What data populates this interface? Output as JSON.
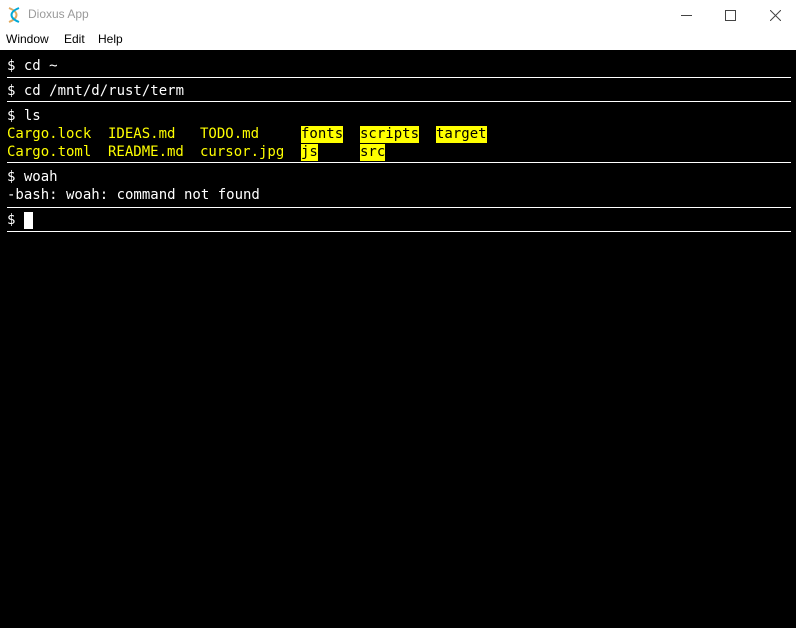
{
  "window": {
    "title": "Dioxus App",
    "minimize_glyph": "—",
    "maximize_glyph": "☐",
    "close_glyph": "✕"
  },
  "menu": {
    "items": [
      "Window",
      "Edit",
      "Help"
    ]
  },
  "terminal": {
    "background": "#000000",
    "foreground": "#ffffff",
    "file_color": "#ffff00",
    "entries": [
      {
        "command": "$ cd ~"
      },
      {
        "command": "$ cd /mnt/d/rust/term"
      },
      {
        "command": "$ ls",
        "files": [
          {
            "name": "Cargo.lock",
            "kind": "file"
          },
          {
            "name": "IDEAS.md",
            "kind": "file"
          },
          {
            "name": "TODO.md",
            "kind": "file"
          },
          {
            "name": "fonts",
            "kind": "directory"
          },
          {
            "name": "scripts",
            "kind": "directory"
          },
          {
            "name": "target",
            "kind": "directory"
          },
          {
            "name": "Cargo.toml",
            "kind": "file"
          },
          {
            "name": "README.md",
            "kind": "file"
          },
          {
            "name": "cursor.jpg",
            "kind": "file"
          },
          {
            "name": "js",
            "kind": "directory"
          },
          {
            "name": "src",
            "kind": "directory"
          }
        ]
      },
      {
        "command": "$ woah",
        "output": "-bash: woah: command not found"
      },
      {
        "prompt": "$"
      }
    ]
  }
}
